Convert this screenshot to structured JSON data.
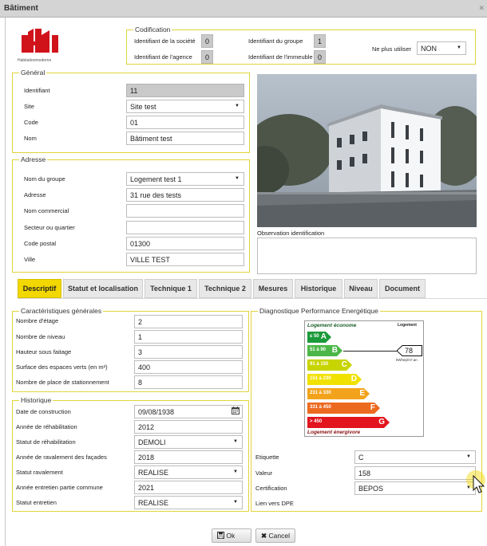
{
  "window": {
    "title": "Bâtiment"
  },
  "logo": {
    "text": "Habitationmoderne"
  },
  "codification": {
    "legend": "Codification",
    "societe_label": "Identifiant de la société",
    "societe_value": "0",
    "agence_label": "Identifiant de l'agence",
    "agence_value": "0",
    "groupe_label": "Identifiant du groupe",
    "groupe_value": "1",
    "immeuble_label": "Identifiant de l'immeuble",
    "immeuble_value": "0",
    "ne_plus_label": "Ne plus utiliser",
    "ne_plus_value": "NON"
  },
  "general": {
    "legend": "Général",
    "identifiant_label": "Identifiant",
    "identifiant_value": "11",
    "site_label": "Site",
    "site_value": "Site test",
    "code_label": "Code",
    "code_value": "01",
    "nom_label": "Nom",
    "nom_value": "Bâtiment test"
  },
  "adresse": {
    "legend": "Adresse",
    "groupe_label": "Nom du groupe",
    "groupe_value": "Logement test 1",
    "adresse_label": "Adresse",
    "adresse_value": "31 rue des tests",
    "commercial_label": "Nom commercial",
    "commercial_value": "",
    "secteur_label": "Secteur ou quartier",
    "secteur_value": "",
    "cp_label": "Code postal",
    "cp_value": "01300",
    "ville_label": "Ville",
    "ville_value": "VILLE TEST"
  },
  "observation": {
    "label": "Observation identification",
    "value": ""
  },
  "tabs": [
    {
      "label": "Descriptif"
    },
    {
      "label": "Statut et localisation"
    },
    {
      "label": "Technique 1"
    },
    {
      "label": "Technique 2"
    },
    {
      "label": "Mesures"
    },
    {
      "label": "Historique"
    },
    {
      "label": "Niveau"
    },
    {
      "label": "Document"
    }
  ],
  "caracteristiques": {
    "legend": "Caractéristiques générales",
    "etage_label": "Nombre d'étage",
    "etage_value": "2",
    "niveau_label": "Nombre de niveau",
    "niveau_value": "1",
    "hauteur_label": "Hauteur sous faitage",
    "hauteur_value": "3",
    "surface_label": "Surface des espaces verts (en m²)",
    "surface_value": "400",
    "stationnement_label": "Nombre de place de stationnement",
    "stationnement_value": "8"
  },
  "historique": {
    "legend": "Historique",
    "construction_label": "Date de construction",
    "construction_value": "09/08/1938",
    "rehab_annee_label": "Année de réhabilitation",
    "rehab_annee_value": "2012",
    "rehab_statut_label": "Statut de réhabilitation",
    "rehab_statut_value": "DEMOLI",
    "ravalement_annee_label": "Année de ravalement des façades",
    "ravalement_annee_value": "2018",
    "ravalement_statut_label": "Statut ravalement",
    "ravalement_statut_value": "REALISE",
    "entretien_annee_label": "Année entretien partie commune",
    "entretien_annee_value": "2021",
    "entretien_statut_label": "Statut entretien",
    "entretien_statut_value": "REALISE"
  },
  "dpe": {
    "legend": "Diagnostique Performance Energétique",
    "econome": "Logement économe",
    "energivore": "Logement énergivore",
    "logement": "Logement",
    "marker_value": "78",
    "unit": "kWhep/m².an",
    "classes": [
      {
        "range": "≤ 50",
        "letter": "A",
        "color": "#1a9a3a"
      },
      {
        "range": "51 à 90",
        "letter": "B",
        "color": "#4cb748"
      },
      {
        "range": "91 à 150",
        "letter": "C",
        "color": "#c8d400"
      },
      {
        "range": "151 à 230",
        "letter": "D",
        "color": "#f1e100"
      },
      {
        "range": "231 à 330",
        "letter": "E",
        "color": "#f3a31b"
      },
      {
        "range": "331 à 450",
        "letter": "F",
        "color": "#ec6a1f"
      },
      {
        "range": "> 450",
        "letter": "G",
        "color": "#e2141e"
      }
    ],
    "etiquette_label": "Etiquette",
    "etiquette_value": "C",
    "valeur_label": "Valeur",
    "valeur_value": "158",
    "certification_label": "Certification",
    "certification_value": "BEPOS",
    "lien_label": "Lien vers DPE"
  },
  "buttons": {
    "ok": "Ok",
    "cancel": "Cancel"
  },
  "colors": {
    "accent": "#f2d800",
    "fieldset_border": "#e0d43c",
    "logo_red": "#d0121b"
  }
}
